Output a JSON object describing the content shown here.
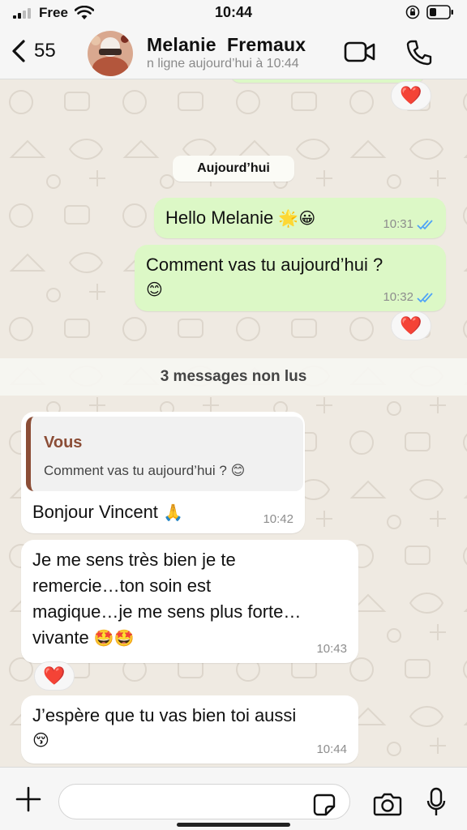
{
  "status_bar": {
    "carrier": "Free",
    "time": "10:44"
  },
  "header": {
    "back_count": "55",
    "contact_name": "Melanie  Fremaux",
    "contact_status": "n ligne aujourd’hui à 10:44"
  },
  "chat": {
    "date_separator": "Aujourd’hui",
    "unread_banner": "3 messages non lus",
    "messages": [
      {
        "direction": "out",
        "text": "Hello Melanie",
        "emoji": "🌟😀",
        "time": "10:31",
        "read": true
      },
      {
        "direction": "out",
        "text": "Comment vas tu aujourd’hui ?",
        "emoji": "😊",
        "time": "10:32",
        "read": true,
        "reaction": "❤️"
      },
      {
        "direction": "in",
        "quote_author": "Vous",
        "quote_text": "Comment vas tu aujourd’hui ?",
        "quote_emoji": "😊",
        "text": "Bonjour Vincent",
        "emoji": "🙏",
        "time": "10:42"
      },
      {
        "direction": "in",
        "lines": [
          "Je me sens très bien je te",
          "remercie…ton soin est",
          "magique…je me sens plus forte…",
          "vivante"
        ],
        "emoji": "🤩🤩",
        "time": "10:43",
        "reaction": "❤️"
      },
      {
        "direction": "in",
        "text": "J’espère que tu vas bien toi aussi",
        "emoji": "😚",
        "time": "10:44"
      }
    ],
    "top_reaction": "❤️"
  },
  "colors": {
    "outgoing_bubble": "#dcf8c6",
    "incoming_bubble": "#ffffff",
    "read_ticks": "#4fa3f7",
    "quote_accent": "#8b4d36",
    "heart": "#e0202c"
  }
}
